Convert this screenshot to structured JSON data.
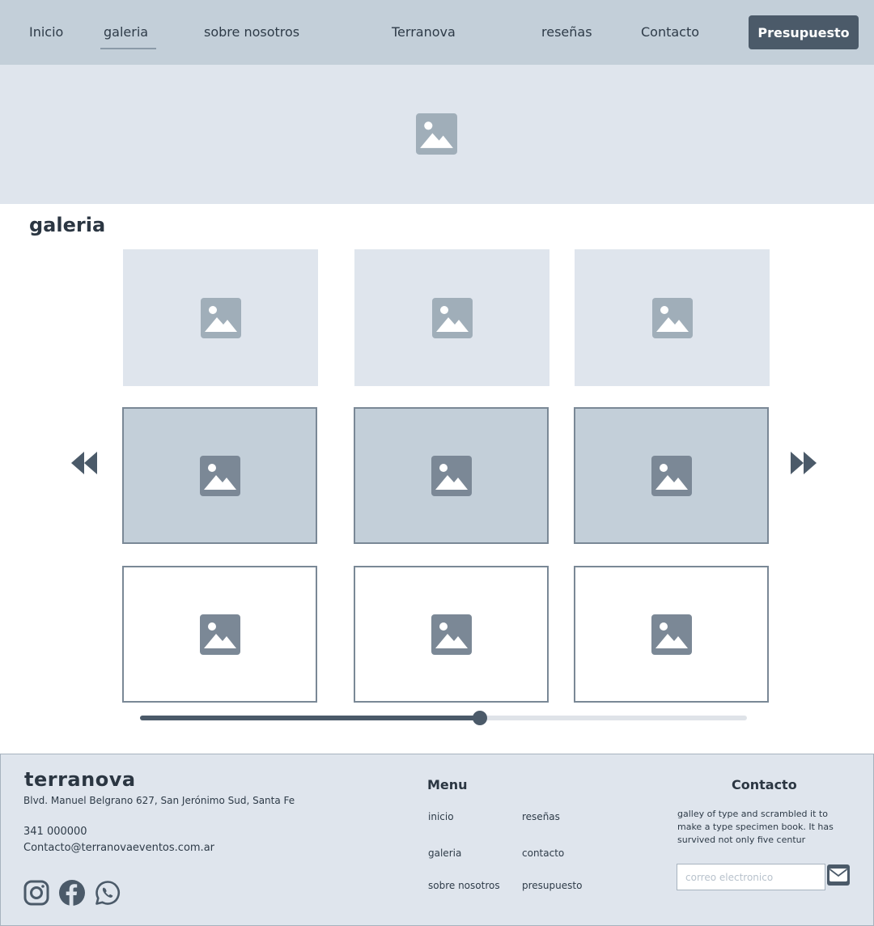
{
  "nav": {
    "items": [
      {
        "label": "Inicio"
      },
      {
        "label": "galeria",
        "active": true
      },
      {
        "label": "sobre nosotros"
      },
      {
        "label": "Terranova"
      },
      {
        "label": "reseñas"
      },
      {
        "label": "Contacto"
      }
    ],
    "cta_label": "Presupuesto"
  },
  "gallery": {
    "title": "galeria",
    "icon": "image-placeholder-icon",
    "prev_icon": "rewind-icon",
    "next_icon": "fast-forward-icon",
    "slider_value": 0.56
  },
  "footer": {
    "brand": "terranova",
    "address": "Blvd. Manuel Belgrano 627, San Jerónimo Sud, Santa Fe",
    "phone": "341 000000",
    "email": "Contacto@terranovaeventos.com.ar",
    "social": [
      "instagram-icon",
      "facebook-icon",
      "whatsapp-icon"
    ],
    "menu": {
      "title": "Menu",
      "links": [
        "inicio",
        "reseñas",
        "galeria",
        "contacto",
        "sobre nosotros",
        "presupuesto"
      ]
    },
    "contact": {
      "title": "Contacto",
      "text": "galley of type and scrambled it to make a type specimen book. It has survived not only five centur",
      "input_placeholder": "correo electronico",
      "send_icon": "envelope-icon"
    }
  },
  "colors": {
    "nav_bg": "#c3cfd9",
    "hero_bg": "#dfe5ed",
    "accent": "#4b5a69",
    "text": "#2b3642"
  }
}
